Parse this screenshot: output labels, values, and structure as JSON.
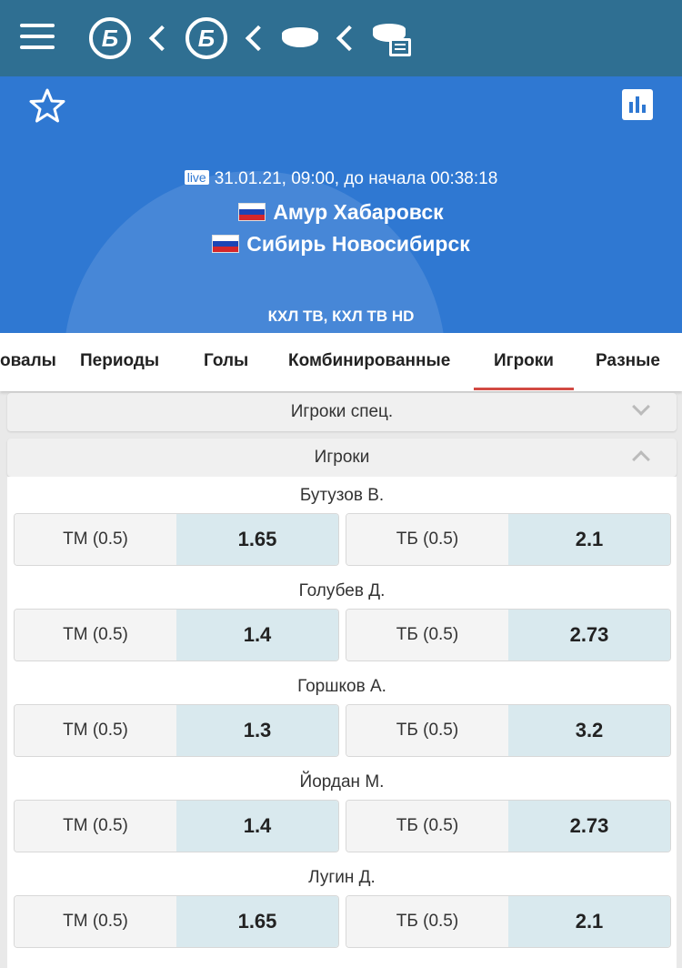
{
  "header": {
    "crumb_b1": "Б",
    "crumb_b2": "Б"
  },
  "match": {
    "live_badge": "live",
    "datetime": "31.01.21, 09:00, до начала  00:38:18",
    "team1": "Амур Хабаровск",
    "team2": "Сибирь Новосибирск",
    "channels": "КХЛ ТВ, КХЛ ТВ HD"
  },
  "tabs": [
    "овалы",
    "Периоды",
    "Голы",
    "Комбинированные",
    "Игроки",
    "Разные"
  ],
  "active_tab": "Игроки",
  "sections": {
    "special": "Игроки спец.",
    "players": "Игроки"
  },
  "players": [
    {
      "name": "Бутузов В.",
      "under_label": "ТМ (0.5)",
      "under_odd": "1.65",
      "over_label": "ТБ (0.5)",
      "over_odd": "2.1"
    },
    {
      "name": "Голубев Д.",
      "under_label": "ТМ (0.5)",
      "under_odd": "1.4",
      "over_label": "ТБ (0.5)",
      "over_odd": "2.73"
    },
    {
      "name": "Горшков А.",
      "under_label": "ТМ (0.5)",
      "under_odd": "1.3",
      "over_label": "ТБ (0.5)",
      "over_odd": "3.2"
    },
    {
      "name": "Йордан М.",
      "under_label": "ТМ (0.5)",
      "under_odd": "1.4",
      "over_label": "ТБ (0.5)",
      "over_odd": "2.73"
    },
    {
      "name": "Лугин Д.",
      "under_label": "ТМ (0.5)",
      "under_odd": "1.65",
      "over_label": "ТБ (0.5)",
      "over_odd": "2.1"
    }
  ],
  "colors": {
    "topbar": "#2f6f92",
    "hero": "#2f78d2",
    "tab_indicator": "#d24a43",
    "odd_bg": "#d9e9ee"
  }
}
